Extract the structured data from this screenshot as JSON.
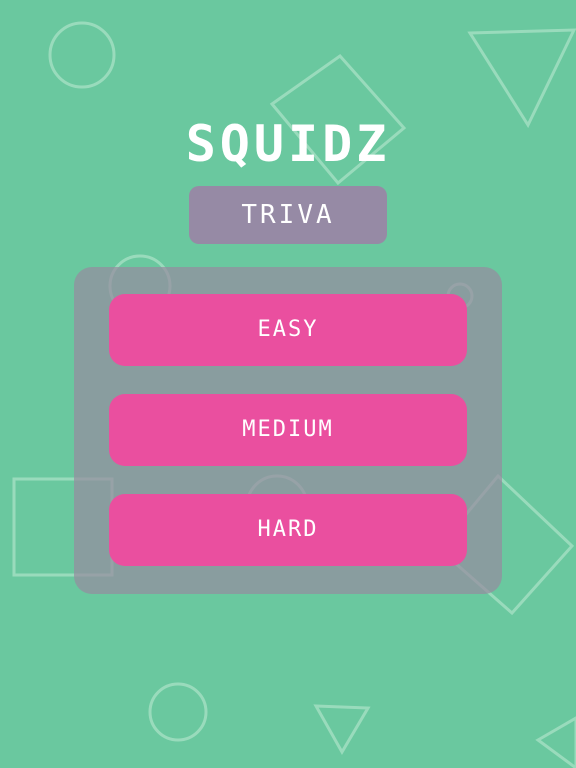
{
  "game": {
    "title": "SQUIDZ",
    "subtitle": "TRIVA"
  },
  "menu": {
    "options": [
      {
        "label": "EASY"
      },
      {
        "label": "MEDIUM"
      },
      {
        "label": "HARD"
      }
    ]
  },
  "colors": {
    "background": "#6ac89f",
    "badge": "#968aa5",
    "panel": "#968ca0",
    "button": "#ea4f9f",
    "text": "#ffffff"
  }
}
